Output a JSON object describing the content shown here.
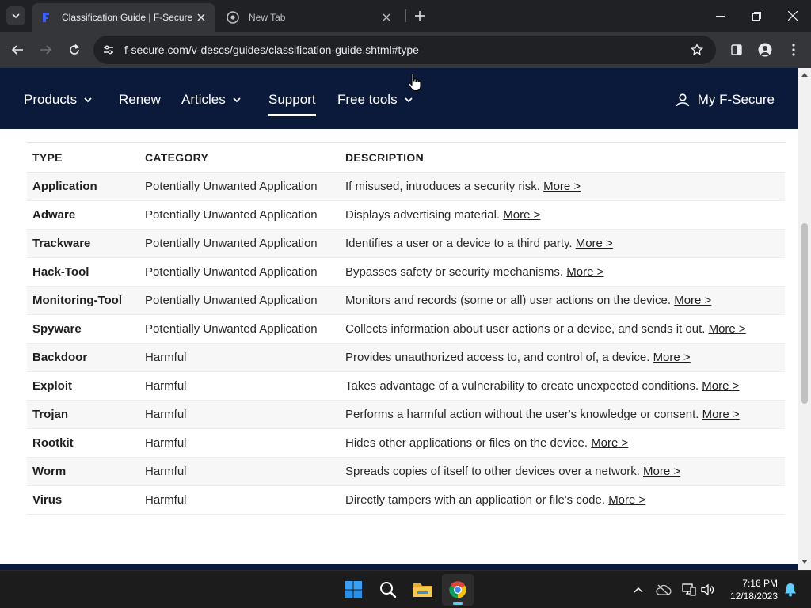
{
  "browser": {
    "tabs": [
      {
        "title": "Classification Guide | F-Secure",
        "active": true
      },
      {
        "title": "New Tab",
        "active": false
      }
    ],
    "url": "f-secure.com/v-descs/guides/classification-guide.shtml#type"
  },
  "site": {
    "nav": [
      {
        "label": "Products",
        "dropdown": true
      },
      {
        "label": "Renew",
        "dropdown": false
      },
      {
        "label": "Articles",
        "dropdown": true
      },
      {
        "label": "Support",
        "dropdown": false,
        "current": true
      },
      {
        "label": "Free tools",
        "dropdown": true
      }
    ],
    "account_label": "My F-Secure"
  },
  "table": {
    "headers": [
      "TYPE",
      "CATEGORY",
      "DESCRIPTION"
    ],
    "more_label": "More >",
    "rows": [
      {
        "type": "Application",
        "category": "Potentially Unwanted Application",
        "description": "If misused, introduces a security risk."
      },
      {
        "type": "Adware",
        "category": "Potentially Unwanted Application",
        "description": "Displays advertising material."
      },
      {
        "type": "Trackware",
        "category": "Potentially Unwanted Application",
        "description": "Identifies a user or a device to a third party."
      },
      {
        "type": "Hack-Tool",
        "category": "Potentially Unwanted Application",
        "description": "Bypasses safety or security mechanisms."
      },
      {
        "type": "Monitoring-Tool",
        "category": "Potentially Unwanted Application",
        "description": "Monitors and records (some or all) user actions on the device."
      },
      {
        "type": "Spyware",
        "category": "Potentially Unwanted Application",
        "description": "Collects information about user actions or a device, and sends it out."
      },
      {
        "type": "Backdoor",
        "category": "Harmful",
        "description": "Provides unauthorized access to, and control of, a device."
      },
      {
        "type": "Exploit",
        "category": "Harmful",
        "description": "Takes advantage of a vulnerability to create unexpected conditions."
      },
      {
        "type": "Trojan",
        "category": "Harmful",
        "description": "Performs a harmful action without the user's knowledge or consent."
      },
      {
        "type": "Rootkit",
        "category": "Harmful",
        "description": "Hides other applications or files on the device."
      },
      {
        "type": "Worm",
        "category": "Harmful",
        "description": "Spreads copies of itself to other devices over a network."
      },
      {
        "type": "Virus",
        "category": "Harmful",
        "description": "Directly tampers with an application or file's code."
      }
    ]
  },
  "taskbar": {
    "apps": [
      "start-icon",
      "search-icon",
      "file-explorer-icon",
      "chrome-icon"
    ],
    "time": "7:16 PM",
    "date": "12/18/2023"
  },
  "colors": {
    "nav_bg": "#0b1a3b",
    "chrome_dark": "#202124",
    "chrome_toolbar": "#35363a",
    "row_stripe": "#f7f7f7"
  }
}
